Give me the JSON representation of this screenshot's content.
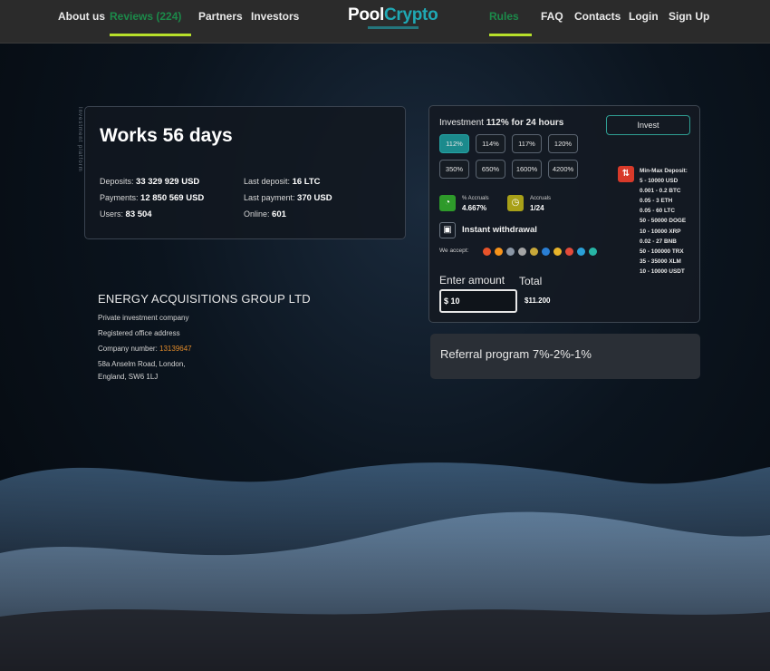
{
  "nav": {
    "left": [
      {
        "label": "About us",
        "active": false
      },
      {
        "label": "Reviews (224)",
        "active": true
      },
      {
        "label": "Partners",
        "active": false
      },
      {
        "label": "Investors",
        "active": false
      }
    ],
    "right": [
      {
        "label": "Rules",
        "active": true
      },
      {
        "label": "FAQ",
        "active": false
      },
      {
        "label": "Contacts",
        "active": false
      },
      {
        "label": "Login",
        "active": false
      },
      {
        "label": "Sign Up",
        "active": false
      }
    ],
    "logo_pool": "Pool",
    "logo_crypto": "Crypto"
  },
  "stats": {
    "vertical_text": "Investment platform",
    "title": "Works 56 days",
    "deposits_label": "Deposits:",
    "deposits_value": "33 329 929 USD",
    "payments_label": "Payments:",
    "payments_value": "12 850 569 USD",
    "users_label": "Users:",
    "users_value": "83 504",
    "last_deposit_label": "Last deposit:",
    "last_deposit_value": "16 LTC",
    "last_payment_label": "Last payment:",
    "last_payment_value": "370 USD",
    "online_label": "Online:",
    "online_value": "601"
  },
  "company": {
    "name": "ENERGY ACQUISITIONS GROUP LTD",
    "line1": "Private investment company",
    "line2": "Registered office address",
    "number_label": "Company number: ",
    "number_value": "13139647",
    "addr1": "58a Anselm Road, London,",
    "addr2": "England, SW6 1LJ"
  },
  "invest": {
    "title_prefix": "Investment ",
    "title_bold": "112% for 24 hours",
    "button": "Invest",
    "plans_row1": [
      "112%",
      "114%",
      "117%",
      "120%"
    ],
    "plans_row2": [
      "350%",
      "650%",
      "1600%",
      "4200%"
    ],
    "selected_plan": "112%",
    "accrual_pct_label": "% Accruals",
    "accrual_pct_value": "4.667%",
    "accrual_label": "Accruals",
    "accrual_value": "1/24",
    "instant": "Instant withdrawal",
    "we_accept": "We accept:",
    "coin_colors": [
      "#e8532a",
      "#f7931a",
      "#8b97a6",
      "#a5a5a5",
      "#c8a83a",
      "#2a7fd4",
      "#e8b42a",
      "#e24a3a",
      "#2aa0d8",
      "#27b5a5"
    ],
    "minmax_title": "Min-Max Deposit:",
    "minmax": [
      "5 - 10000 USD",
      "0.001 - 0.2 BTC",
      "0.05 - 3 ETH",
      "0.05 - 60 LTC",
      "50 - 50000 DOGE",
      "10 - 10000 XRP",
      "0.02 - 27 BNB",
      "50 - 100000 TRX",
      "35 - 35000 XLM",
      "10 - 10000 USDT"
    ],
    "enter_amount": "Enter amount",
    "total": "Total",
    "amount_value": "$ 10",
    "total_value": "$11.200"
  },
  "referral": {
    "text": "Referral program 7%-2%-1%"
  }
}
